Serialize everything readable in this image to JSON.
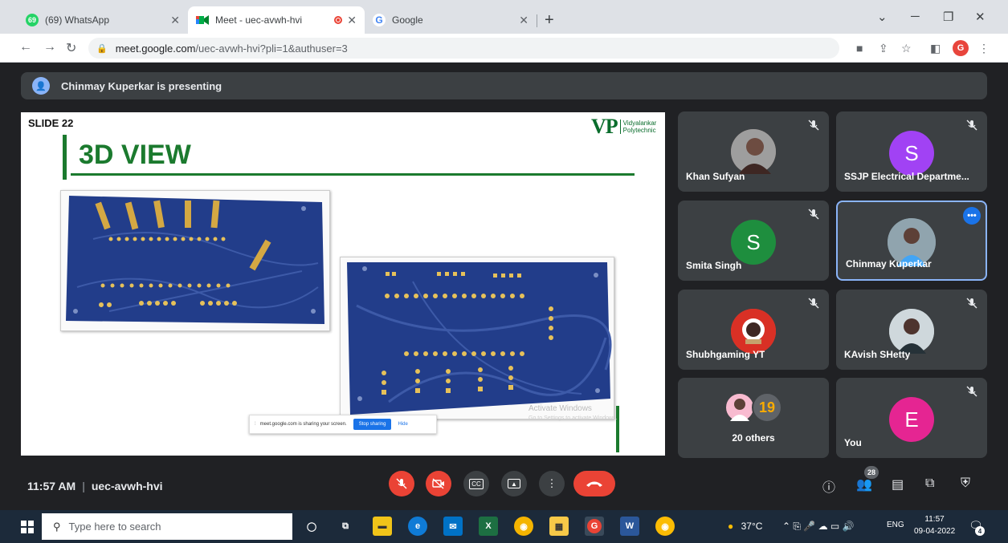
{
  "browser": {
    "tabs": [
      {
        "title": "(69) WhatsApp",
        "favicon_text": "69",
        "favicon_color": "#25d366"
      },
      {
        "title": "Meet - uec-avwh-hvi",
        "recording_color": "#ea4335"
      },
      {
        "title": "Google",
        "favicon_text": "G",
        "favicon_color": "#4285f4"
      }
    ],
    "url_host": "meet.google.com",
    "url_path": "/uec-avwh-hvi?pli=1&authuser=3",
    "profile_initial": "G"
  },
  "meet": {
    "presenting_text": "Chinmay Kuperkar is presenting",
    "slide": {
      "number_label": "SLIDE 22",
      "title": "3D VIEW",
      "logo_text": "VP",
      "logo_name": "Vidyalankar Polytechnic",
      "activate_title": "Activate Windows",
      "activate_sub": "Go to Settings to activate Windows.",
      "share_popup": {
        "message": "meet.google.com is sharing your screen.",
        "stop_label": "Stop sharing",
        "hide_label": "Hide"
      }
    },
    "participants": [
      {
        "name": "Khan Sufyan",
        "muted": true
      },
      {
        "name": "SSJP Electrical Departme...",
        "initial": "S",
        "color": "#a142f4",
        "muted": true
      },
      {
        "name": "Smita Singh",
        "initial": "S",
        "color": "#1e8e3e",
        "muted": true
      },
      {
        "name": "Chinmay Kuperkar",
        "muted": false,
        "speaking": true
      },
      {
        "name": "Shubhgaming YT",
        "muted": true
      },
      {
        "name": "KAvish SHetty",
        "muted": true
      },
      {
        "name": "20 others",
        "badge": "19"
      },
      {
        "name": "You",
        "initial": "E",
        "color": "#e52592",
        "muted": true
      }
    ],
    "time": "11:57 AM",
    "meeting_code": "uec-avwh-hvi",
    "participant_count": "28"
  },
  "taskbar": {
    "search_placeholder": "Type here to search",
    "weather": "37°C",
    "language": "ENG",
    "clock_time": "11:57",
    "clock_date": "09-04-2022",
    "notification_count": "4"
  }
}
